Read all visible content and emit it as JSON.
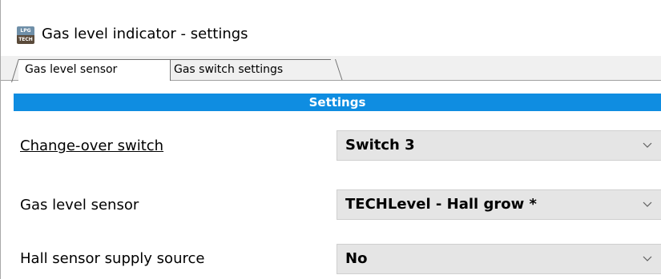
{
  "window": {
    "title": "Gas level indicator - settings",
    "icon_name": "lpg-tech-app-icon",
    "icon_text_top": "LPG",
    "icon_text_bottom": "TECH"
  },
  "tabs": [
    {
      "label": "Gas level sensor",
      "selected": true
    },
    {
      "label": "Gas switch settings",
      "selected": false
    }
  ],
  "section": {
    "header": "Settings",
    "color": "#0f8de1"
  },
  "settings": [
    {
      "label": "Change-over switch",
      "value": "Switch 3",
      "icon": "chevron-down-icon"
    },
    {
      "label": "Gas level sensor",
      "value": "TECHLevel - Hall grow *",
      "icon": "chevron-down-icon"
    },
    {
      "label": "Hall sensor supply source",
      "value": "No",
      "icon": "chevron-down-icon"
    }
  ]
}
